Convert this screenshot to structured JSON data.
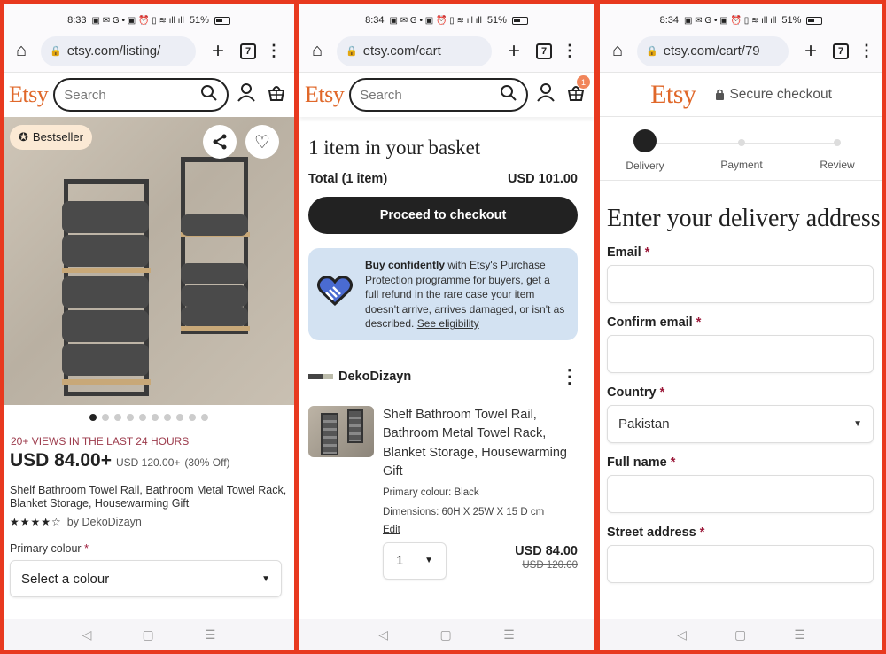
{
  "screens": [
    {
      "status": {
        "time": "8:33",
        "battery": "51%"
      },
      "browser": {
        "url": "etsy.com/listing/",
        "tab_count": "7"
      },
      "header": {
        "logo": "Etsy",
        "search_placeholder": "Search"
      },
      "listing": {
        "badge": "Bestseller",
        "image_count": 10,
        "active_image": 1,
        "views_notice": "20+ VIEWS IN THE LAST 24 HOURS",
        "price": "USD 84.00+",
        "original_price": "USD 120.00+",
        "discount": "(30% Off)",
        "title": "Shelf Bathroom Towel Rail, Bathroom Metal Towel Rack, Blanket Storage, Housewarming Gift",
        "rating": 4.5,
        "rating_stars": "★★★★☆",
        "seller": "by DekoDizayn",
        "option_label": "Primary colour",
        "option_required": "*",
        "option_placeholder": "Select a colour"
      }
    },
    {
      "status": {
        "time": "8:34",
        "battery": "51%"
      },
      "browser": {
        "url": "etsy.com/cart",
        "tab_count": "7"
      },
      "header": {
        "logo": "Etsy",
        "search_placeholder": "Search",
        "cart_badge": "1"
      },
      "cart": {
        "heading": "1 item in your basket",
        "total_label": "Total (1 item)",
        "total_value": "USD 101.00",
        "checkout_button": "Proceed to checkout",
        "protection_bold": "Buy confidently",
        "protection_text": " with Etsy's Purchase Protection programme for buyers, get a full refund in the rare case your item doesn't arrive, arrives damaged, or isn't as described. ",
        "protection_link": "See eligibility",
        "shop_name": "DekoDizayn",
        "item": {
          "title": "Shelf Bathroom Towel Rail, Bathroom Metal Towel Rack, Blanket Storage, Housewarming Gift",
          "attr_colour": "Primary colour: Black",
          "attr_dimensions": "Dimensions: 60H X 25W X 15 D cm",
          "edit_label": "Edit",
          "quantity": "1",
          "price": "USD 84.00",
          "original_price": "USD 120.00"
        }
      }
    },
    {
      "status": {
        "time": "8:34",
        "battery": "51%"
      },
      "browser": {
        "url": "etsy.com/cart/79",
        "tab_count": "7"
      },
      "header": {
        "logo": "Etsy",
        "secure_label": "Secure checkout"
      },
      "checkout": {
        "steps": [
          {
            "label": "Delivery",
            "active": true
          },
          {
            "label": "Payment",
            "active": false
          },
          {
            "label": "Review",
            "active": false
          }
        ],
        "heading": "Enter your delivery address",
        "fields": [
          {
            "label": "Email",
            "required": "*",
            "value": ""
          },
          {
            "label": "Confirm email",
            "required": "*",
            "value": ""
          },
          {
            "label": "Country",
            "required": "*",
            "value": "Pakistan"
          },
          {
            "label": "Full name",
            "required": "*",
            "value": ""
          },
          {
            "label": "Street address",
            "required": "*",
            "value": ""
          }
        ]
      }
    }
  ],
  "icons": {
    "home": "⌂",
    "lock": "🔒",
    "plus": "+",
    "menu": "⋮",
    "search": "⚲",
    "user": "👤",
    "basket": "🧺",
    "share": "⤴",
    "heart": "♡",
    "caret": "▼",
    "back": "◁",
    "square": "▢",
    "recents": "☰",
    "award": "🏅",
    "handshake": "🤝"
  }
}
